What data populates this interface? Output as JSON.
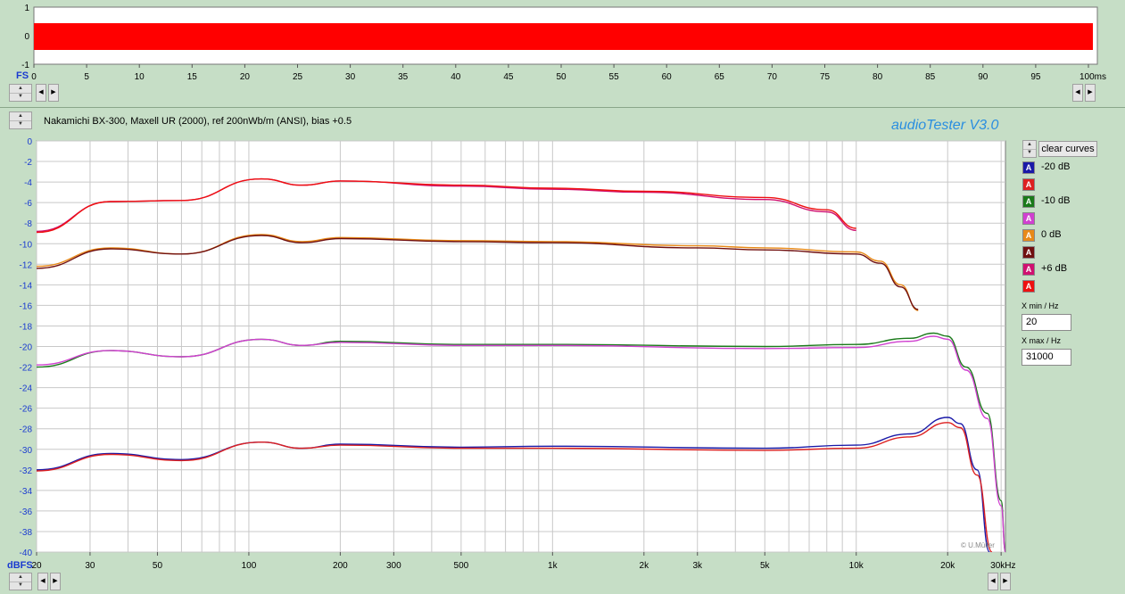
{
  "waveform": {
    "y_ticks": [
      "1",
      "0",
      "-1"
    ],
    "fs_label": "FS",
    "x_ticks": [
      "0",
      "5",
      "10",
      "15",
      "20",
      "25",
      "30",
      "35",
      "40",
      "45",
      "50",
      "55",
      "60",
      "65",
      "70",
      "75",
      "80",
      "85",
      "90",
      "95",
      "100ms"
    ],
    "color": "#ff0000"
  },
  "header": {
    "title": "Nakamichi BX-300, Maxell UR (2000), ref 200nWb/m (ANSI), bias +0.5",
    "brand": "audioTester  V3.0"
  },
  "sidebar": {
    "clear_label": "clear curves",
    "legend": [
      {
        "label": "-20 dB",
        "color": "#1a1aa8"
      },
      {
        "label": "",
        "color": "#dd2020"
      },
      {
        "label": "-10 dB",
        "color": "#1a7a1a"
      },
      {
        "label": "",
        "color": "#d040d0"
      },
      {
        "label": "0 dB",
        "color": "#e88a18"
      },
      {
        "label": "",
        "color": "#701010"
      },
      {
        "label": "+6 dB",
        "color": "#d01070"
      },
      {
        "label": "",
        "color": "#ee1010"
      }
    ],
    "legend_glyph": "A",
    "xmin_label": "X min / Hz",
    "xmin_value": "20",
    "xmax_label": "X max / Hz",
    "xmax_value": "31000"
  },
  "axis": {
    "y_unit": "dBFS",
    "credit": "© U.Müller"
  },
  "chart_data": {
    "type": "line",
    "xscale": "log",
    "xlim": [
      20,
      31000
    ],
    "ylim": [
      -40,
      0
    ],
    "y_ticks": [
      0,
      -2,
      -4,
      -6,
      -8,
      -10,
      -12,
      -14,
      -16,
      -18,
      -20,
      -22,
      -24,
      -26,
      -28,
      -30,
      -32,
      -34,
      -36,
      -38,
      -40
    ],
    "x_ticks": [
      {
        "v": 20,
        "label": "20"
      },
      {
        "v": 30,
        "label": "30"
      },
      {
        "v": 50,
        "label": "50"
      },
      {
        "v": 100,
        "label": "100"
      },
      {
        "v": 200,
        "label": "200"
      },
      {
        "v": 300,
        "label": "300"
      },
      {
        "v": 500,
        "label": "500"
      },
      {
        "v": 1000,
        "label": "1k"
      },
      {
        "v": 2000,
        "label": "2k"
      },
      {
        "v": 3000,
        "label": "3k"
      },
      {
        "v": 5000,
        "label": "5k"
      },
      {
        "v": 10000,
        "label": "10k"
      },
      {
        "v": 20000,
        "label": "20k"
      },
      {
        "v": 30000,
        "label": "30kHz"
      }
    ],
    "grid": true,
    "series": [
      {
        "name": "+6 dB",
        "color": "#d01070",
        "points": [
          [
            20,
            -8.8
          ],
          [
            35,
            -5.9
          ],
          [
            60,
            -5.8
          ],
          [
            110,
            -3.7
          ],
          [
            150,
            -4.3
          ],
          [
            200,
            -3.9
          ],
          [
            500,
            -4.4
          ],
          [
            1000,
            -4.7
          ],
          [
            2000,
            -5.0
          ],
          [
            5000,
            -5.7
          ],
          [
            8000,
            -6.9
          ],
          [
            10000,
            -8.7
          ]
        ]
      },
      {
        "name": "",
        "color": "#ee1010",
        "points": [
          [
            20,
            -8.9
          ],
          [
            35,
            -5.9
          ],
          [
            60,
            -5.8
          ],
          [
            110,
            -3.7
          ],
          [
            150,
            -4.3
          ],
          [
            200,
            -3.9
          ],
          [
            500,
            -4.3
          ],
          [
            1000,
            -4.6
          ],
          [
            2000,
            -4.9
          ],
          [
            5000,
            -5.5
          ],
          [
            8000,
            -6.7
          ],
          [
            10000,
            -8.5
          ]
        ]
      },
      {
        "name": "0 dB",
        "color": "#e88a18",
        "points": [
          [
            20,
            -12.2
          ],
          [
            35,
            -10.4
          ],
          [
            60,
            -11.0
          ],
          [
            110,
            -9.1
          ],
          [
            150,
            -9.8
          ],
          [
            200,
            -9.4
          ],
          [
            500,
            -9.7
          ],
          [
            1000,
            -9.8
          ],
          [
            3000,
            -10.2
          ],
          [
            5000,
            -10.4
          ],
          [
            10000,
            -10.8
          ],
          [
            12000,
            -11.7
          ],
          [
            14000,
            -14.0
          ],
          [
            16000,
            -16.5
          ]
        ]
      },
      {
        "name": "",
        "color": "#701010",
        "points": [
          [
            20,
            -12.4
          ],
          [
            35,
            -10.5
          ],
          [
            60,
            -11.0
          ],
          [
            110,
            -9.2
          ],
          [
            150,
            -9.9
          ],
          [
            200,
            -9.5
          ],
          [
            500,
            -9.8
          ],
          [
            1000,
            -9.9
          ],
          [
            3000,
            -10.4
          ],
          [
            5000,
            -10.6
          ],
          [
            10000,
            -11.0
          ],
          [
            12000,
            -11.9
          ],
          [
            14000,
            -14.2
          ],
          [
            16000,
            -16.4
          ]
        ]
      },
      {
        "name": "-10 dB",
        "color": "#1a7a1a",
        "points": [
          [
            20,
            -22.0
          ],
          [
            35,
            -20.4
          ],
          [
            60,
            -21.0
          ],
          [
            110,
            -19.3
          ],
          [
            150,
            -19.9
          ],
          [
            200,
            -19.5
          ],
          [
            500,
            -19.8
          ],
          [
            1000,
            -19.8
          ],
          [
            5000,
            -20.0
          ],
          [
            10000,
            -19.8
          ],
          [
            15000,
            -19.2
          ],
          [
            18000,
            -18.7
          ],
          [
            20000,
            -19.0
          ],
          [
            23000,
            -22.0
          ],
          [
            27000,
            -26.5
          ],
          [
            30000,
            -35.0
          ],
          [
            31000,
            -40.0
          ]
        ]
      },
      {
        "name": "",
        "color": "#d040d0",
        "points": [
          [
            20,
            -21.8
          ],
          [
            35,
            -20.4
          ],
          [
            60,
            -21.0
          ],
          [
            110,
            -19.3
          ],
          [
            150,
            -19.9
          ],
          [
            200,
            -19.6
          ],
          [
            500,
            -19.9
          ],
          [
            1000,
            -19.9
          ],
          [
            5000,
            -20.2
          ],
          [
            10000,
            -20.1
          ],
          [
            15000,
            -19.5
          ],
          [
            18000,
            -19.0
          ],
          [
            20000,
            -19.3
          ],
          [
            23000,
            -22.3
          ],
          [
            27000,
            -27.0
          ],
          [
            30000,
            -35.5
          ],
          [
            31000,
            -40.0
          ]
        ]
      },
      {
        "name": "-20 dB",
        "color": "#1a1aa8",
        "points": [
          [
            20,
            -32.0
          ],
          [
            35,
            -30.4
          ],
          [
            60,
            -31.0
          ],
          [
            110,
            -29.3
          ],
          [
            150,
            -29.9
          ],
          [
            200,
            -29.5
          ],
          [
            500,
            -29.8
          ],
          [
            1000,
            -29.7
          ],
          [
            5000,
            -29.9
          ],
          [
            10000,
            -29.6
          ],
          [
            15000,
            -28.5
          ],
          [
            20000,
            -26.9
          ],
          [
            22000,
            -27.5
          ],
          [
            25000,
            -32.0
          ],
          [
            27500,
            -40.0
          ]
        ]
      },
      {
        "name": "",
        "color": "#dd2020",
        "points": [
          [
            20,
            -32.1
          ],
          [
            35,
            -30.5
          ],
          [
            60,
            -31.1
          ],
          [
            110,
            -29.3
          ],
          [
            150,
            -29.9
          ],
          [
            200,
            -29.6
          ],
          [
            500,
            -29.9
          ],
          [
            1000,
            -29.9
          ],
          [
            5000,
            -30.1
          ],
          [
            10000,
            -29.9
          ],
          [
            15000,
            -28.8
          ],
          [
            20000,
            -27.4
          ],
          [
            22000,
            -27.9
          ],
          [
            25000,
            -32.5
          ],
          [
            28000,
            -40.0
          ]
        ]
      }
    ]
  }
}
